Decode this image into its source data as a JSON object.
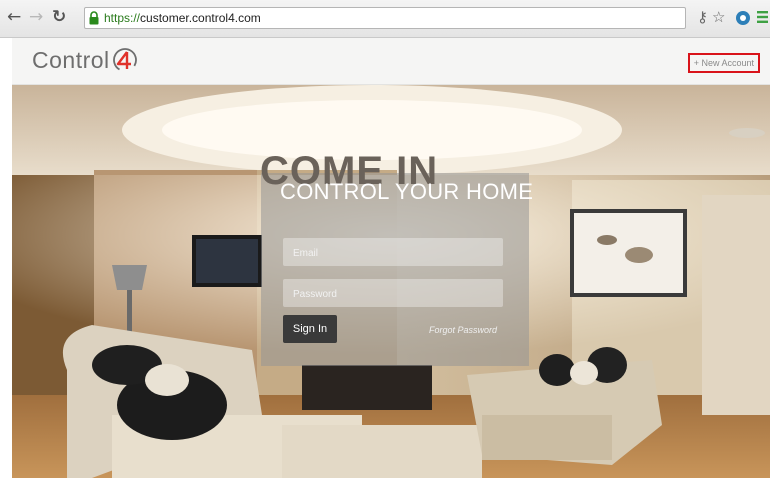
{
  "browser": {
    "back_icon": "back-arrow-icon",
    "forward_icon": "forward-arrow-icon",
    "reload_icon": "reload-icon",
    "url_scheme": "https://",
    "url_host": "customer.control4.com",
    "extensions": [
      "key-icon",
      "star-icon",
      "extension-icon",
      "menu-icon"
    ]
  },
  "header": {
    "logo_text": "Control",
    "new_account_label": "+ New Account"
  },
  "login": {
    "title": "COME IN",
    "subtitle": "CONTROL YOUR HOME",
    "email_placeholder": "Email",
    "password_placeholder": "Password",
    "signin_label": "Sign In",
    "forgot_label": "Forgot Password"
  },
  "colors": {
    "highlight_border": "#d9131a",
    "signin_bg": "#3a3a3a",
    "logo_accent": "#e0322a"
  }
}
